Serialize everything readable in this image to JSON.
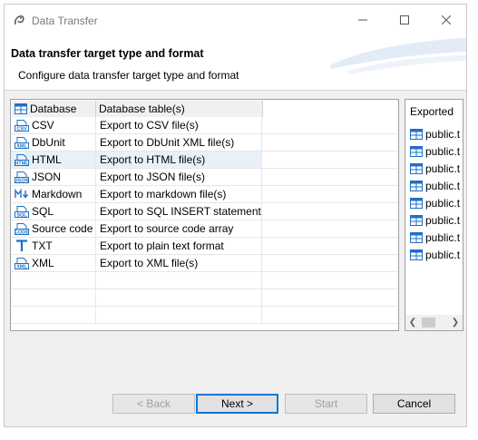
{
  "window": {
    "title": "Data Transfer"
  },
  "header": {
    "title": "Data transfer target type and format",
    "subtitle": "Configure data transfer target type and format"
  },
  "table": {
    "columns": [
      "Database",
      "Database table(s)"
    ],
    "rows": [
      {
        "icon": "csv-icon",
        "name": "CSV",
        "desc": "Export to CSV file(s)"
      },
      {
        "icon": "xml-icon",
        "name": "DbUnit",
        "desc": "Export to DbUnit XML file(s)"
      },
      {
        "icon": "html-icon",
        "name": "HTML",
        "desc": "Export to HTML file(s)",
        "selected": true
      },
      {
        "icon": "json-icon",
        "name": "JSON",
        "desc": "Export to JSON file(s)"
      },
      {
        "icon": "markdown-icon",
        "name": "Markdown",
        "desc": "Export to markdown file(s)"
      },
      {
        "icon": "sql-icon",
        "name": "SQL",
        "desc": "Export to SQL INSERT statements"
      },
      {
        "icon": "code-icon",
        "name": "Source code",
        "desc": "Export to source code array"
      },
      {
        "icon": "text-icon",
        "name": "TXT",
        "desc": "Export to plain text format"
      },
      {
        "icon": "xml-icon",
        "name": "XML",
        "desc": "Export to XML file(s)"
      }
    ]
  },
  "exported": {
    "header": "Exported",
    "items": [
      "public.t",
      "public.t",
      "public.t",
      "public.t",
      "public.t",
      "public.t",
      "public.t",
      "public.t"
    ]
  },
  "buttons": {
    "back": "< Back",
    "next": "Next >",
    "start": "Start",
    "cancel": "Cancel"
  },
  "colors": {
    "accent": "#0078d7",
    "table_icon": "#1e6fc7",
    "selection": "#e8f1fa"
  }
}
